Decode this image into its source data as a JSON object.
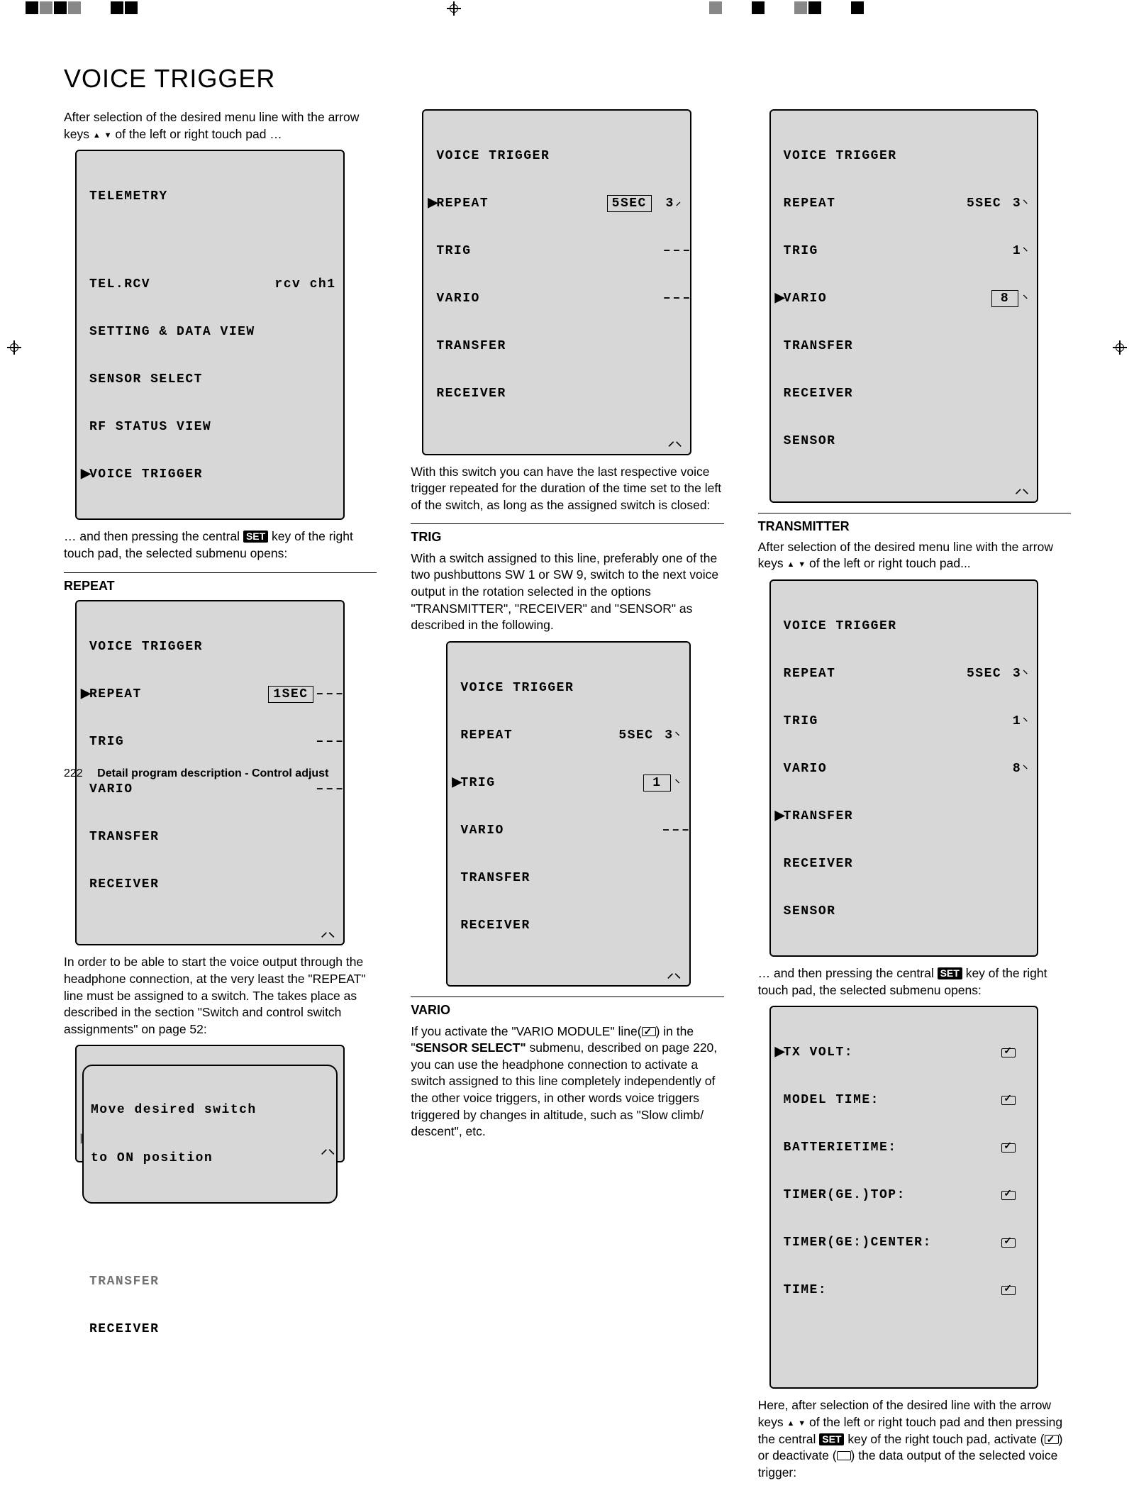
{
  "page_title": "VOICE TRIGGER",
  "footer": {
    "page_number": "222",
    "section": "Detail program description - Control adjust"
  },
  "col1": {
    "p1a": "After selection of the desired menu line with the arrow keys ",
    "p1b": " of the left or right touch pad …",
    "p2a": "… and then pressing the central ",
    "p2b": "SET",
    "p2c": " key of the right touch pad, the selected submenu opens:",
    "h_repeat": "REPEAT",
    "p3": "In order to be able to start the voice output through the headphone connection, at the very least the \"REPEAT\" line must be assigned to a switch. The takes place as described in the section \"Switch and control switch assignments\" on page 52:"
  },
  "col2": {
    "p1": "With this switch you can have the last respective voice trigger repeated for the duration of the time set to the left of the switch, as long as the assigned switch is closed:",
    "h_trig": "TRIG",
    "p2": "With a switch assigned to this line, preferably one of the two pushbuttons SW 1 or SW 9, switch to the next voice output in the rotation selected in the options \"TRANSMITTER\", \"RECEIVER\" and \"SENSOR\" as described in the following.",
    "h_vario": "VARIO",
    "p3a": "If you activate the \"VARIO MODULE\" line(",
    "p3b": ") in the \"",
    "p3c": "SENSOR SELECT\"",
    "p3d": " submenu, described on page 220, you can use the headphone connection to activate a switch assigned to this line completely independently of the other voice triggers, in other words voice triggers triggered  by changes in altitude, such as  \"Slow climb/ descent\", etc."
  },
  "col3": {
    "h_trans": "TRANSMITTER",
    "p1a": "After selection of the desired menu line with the arrow keys ",
    "p1b": " of the left or right touch pad...",
    "p2a": "… and then pressing the central ",
    "p2b": "SET",
    "p2c": " key of the right touch pad, the selected submenu opens:",
    "p3a": "Here, after selection of the desired line with the arrow keys ",
    "p3b": " of the left or right touch pad and then pressing the central ",
    "p3c": "SET",
    "p3d": " key of the right touch pad, activate (",
    "p3e": ") or deactivate (",
    "p3f": ") the data output of the selected voice trigger:"
  },
  "lcd_telemetry": {
    "title": "TELEMETRY",
    "l1a": "TEL.RCV",
    "l1b": "rcv ch1",
    "l2": "SETTING & DATA VIEW",
    "l3": "SENSOR SELECT",
    "l4": "RF STATUS VIEW",
    "l5": "VOICE TRIGGER"
  },
  "lcd_vt_base": {
    "title": "VOICE TRIGGER",
    "r_repeat": "REPEAT",
    "r_trig": "TRIG",
    "r_vario": "VARIO",
    "r_transfer": "TRANSFER",
    "r_receiver": "RECEIVER",
    "r_sensor": "SENSOR"
  },
  "lcd_repeat_1sec": {
    "repeat_val": "1SEC",
    "repeat_sw": "–––",
    "trig_sw": "–––",
    "vario_sw": "–––"
  },
  "lcd_popup": {
    "line1": "Move desired switch",
    "line2": "to ON position"
  },
  "lcd_repeat_5sec3": {
    "repeat_val": "5SEC",
    "repeat_sw": "3",
    "trig_sw": "–––",
    "vario_sw": "–––"
  },
  "lcd_trig": {
    "repeat_val": "5SEC",
    "repeat_sw": "3",
    "trig_sw": "1",
    "vario_sw": "–––"
  },
  "lcd_vario": {
    "repeat_val": "5SEC",
    "repeat_sw": "3",
    "trig_sw": "1",
    "vario_sw": "8"
  },
  "lcd_transfer": {
    "repeat_val": "5SEC",
    "repeat_sw": "3",
    "trig_sw": "1",
    "vario_sw": "8"
  },
  "lcd_tx": {
    "l1": "TX VOLT:",
    "l2": "MODEL TIME:",
    "l3": "BATTERIETIME:",
    "l4": "TIMER(GE.)TOP:",
    "l5": "TIMER(GE:)CENTER:",
    "l6": "TIME:"
  }
}
